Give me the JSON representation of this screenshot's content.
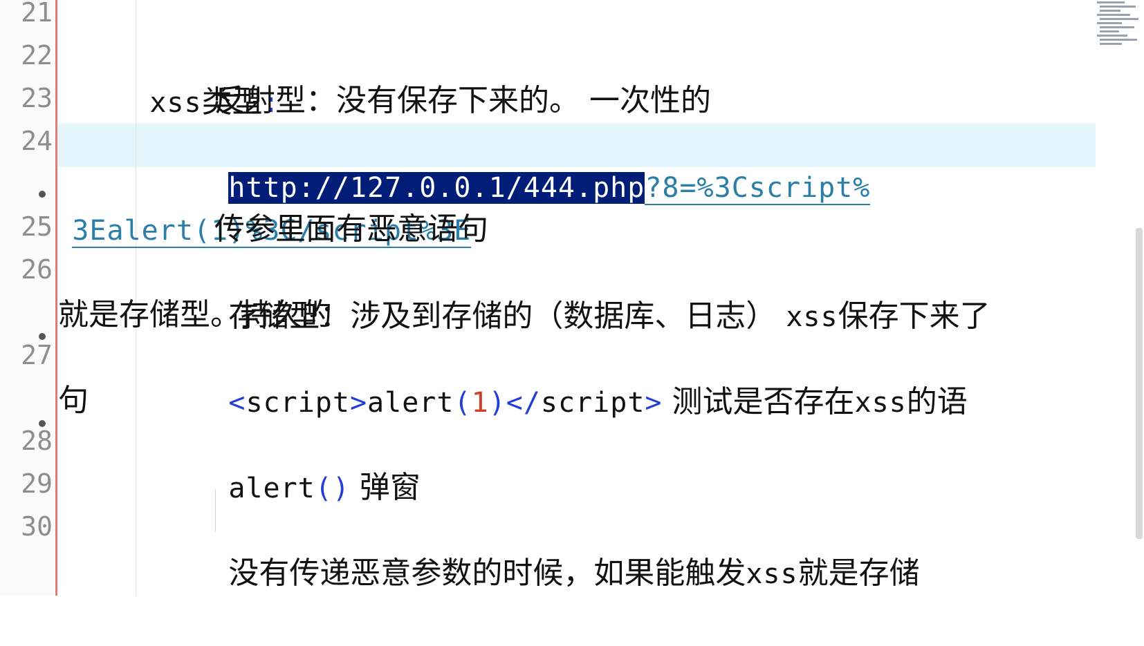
{
  "editor": {
    "line_numbers": [
      "21",
      "22",
      "23",
      "24",
      "25",
      "26",
      "27",
      "28",
      "29",
      "30"
    ],
    "lines": {
      "l22": {
        "prefix": "xss",
        "cn": "类型",
        "colon": ":"
      },
      "l23": {
        "text": "反射型：没有保存下来的。 一次性的"
      },
      "l24": {
        "selected": "http://127.0.0.1/444.php",
        "rest": "?8=%3Cscript%",
        "wrap": "3Ealert(1)%3C/script%3E"
      },
      "l25": {
        "text": "传参里面有恶意语句"
      },
      "l26": {
        "part1": "存储型：涉及到存储的（数据库、日志） ",
        "xss": "xss",
        "part2": "保存下来了",
        "wrap": "就是存储型。持久的"
      },
      "l27": {
        "lt1": "<",
        "tag1": "script",
        "gt1": ">",
        "fn": "alert",
        "lp": "(",
        "num": "1",
        "rp": ")",
        "lt2": "</",
        "tag2": "script",
        "gt2": ">",
        "cn1": " 测试是否存在",
        "xss": "xss",
        "cn2": "的语",
        "wrap": "句"
      },
      "l28": {
        "fn": "alert",
        "parens": "()",
        "cn": " 弹窗"
      },
      "l30": {
        "cn1": "没有传递恶意参数的时候，如果能触发",
        "xss": "xss",
        "cn2": "就是存储"
      }
    }
  },
  "colors": {
    "selection": "#001e78",
    "line_highlight": "#e5f5fc",
    "keyword_blue": "#1f3fd6",
    "number_red": "#d23d2a",
    "url_teal": "#2b7ea8",
    "gutter_border": "#e07a72"
  }
}
